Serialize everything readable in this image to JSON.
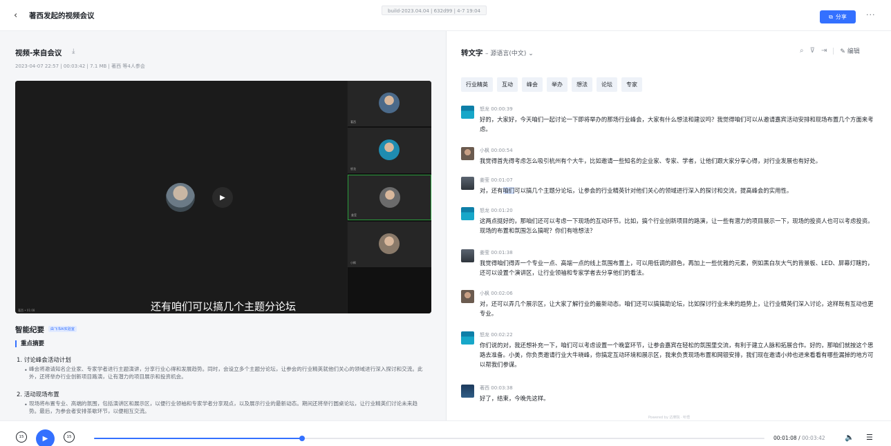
{
  "header": {
    "back_icon": "‹",
    "title": "著西发起的视频会议",
    "build": "build-2023.04.04 | 632d99 | 4-7 19:04",
    "share_label": "分享",
    "share_icon": "⧉",
    "more_icon": "···"
  },
  "left": {
    "video_title": "视频-来自会议",
    "download_icon": "⤓",
    "meta": "2023-04-07 22:57  |  00:03:42  |  7.1 MB  |  著西 等4人参会",
    "play_icon": "▶",
    "caption": "还有咱们可以搞几个主题分论坛",
    "stage_label": "著西 • 01:08",
    "tiles": [
      {
        "name": "著西",
        "color": "#4b6a8a"
      },
      {
        "name": "怒龙",
        "color": "#1f8cb0"
      },
      {
        "name": "姜莹",
        "color": "#6b6b6b"
      },
      {
        "name": "小枫",
        "color": "#8a7a6a"
      }
    ],
    "smart_title": "智能纪要",
    "smart_badge": "由飞书AI实验室",
    "key_points": "重点摘要",
    "sections": [
      {
        "heading": "1. 讨论峰会活动计划",
        "body": "峰会将邀请知名企业家、专家学者进行主题演讲，分享行业心得和发展趋势。同时，会设立多个主题分论坛，让参会的行业精英就他们关心的领域进行深入探讨和交流。此外，还将举办行业创新项目路演，让有潜力的项目展示和投资机会。"
      },
      {
        "heading": "2. 活动现场布置",
        "body": "现场将布置专业、高端的氛围，包括演讲区和展示区，以便行业领袖和专家学者分享观点，以及展示行业的最新动态。期间还将举行圆桌论坛，让行业精英们讨论未来趋势。最后，为参会者安排茶歇环节，以便相互交流。"
      }
    ]
  },
  "right": {
    "title": "转文字",
    "lang": "– 源语言(中文) ⌄",
    "tool_icons": [
      "⌕",
      "⊽",
      "⇥"
    ],
    "edit_label": "✎ 编辑",
    "keywords": [
      "行业精英",
      "互动",
      "峰会",
      "举办",
      "想法",
      "论坛",
      "专家"
    ],
    "entries": [
      {
        "speaker": "怒龙",
        "time": "00:00:39",
        "avatar": "teal",
        "text": "好的，大家好，今天咱们一起讨论一下即将举办的那场行业峰会，大家有什么想法和建议吗？我觉得咱们可以从邀请嘉宾活动安排和现场布置几个方面来考虑。"
      },
      {
        "speaker": "小枫",
        "time": "00:00:54",
        "avatar": "person",
        "text": "我觉得首先得考虑怎么吸引杭州有个大牛，比如邀请一些知名的企业家、专家、学者，让他们跟大家分享心得，对行业发展也有好处。"
      },
      {
        "speaker": "姜莹",
        "time": "00:01:07",
        "avatar": "gray",
        "pre": "对，还有",
        "hl": "咱们",
        "post": "可以搞几个主题分论坛，让参会的行业精英针对他们关心的领域进行深入的探讨和交流，提高峰会的实用性。"
      },
      {
        "speaker": "怒龙",
        "time": "00:01:20",
        "avatar": "teal",
        "text": "这两点挺好的，那咱们还可以考虑一下现场的互动环节。比如，搞个行业创新项目的路演，让一些有潜力的项目展示一下，现场的投资人也可以考虑投资。现场的布置和氛围怎么搞呢？你们有啥想法？"
      },
      {
        "speaker": "姜莹",
        "time": "00:01:38",
        "avatar": "gray",
        "text": "我觉得咱们得弄一个专业一点、高端一点的线上氛围布置上，可以用低调的颜色，再加上一些优雅的元素，例如黑白灰大气的背景板、LED、屏幕灯瞎的，还可以设置个演讲区，让行业领袖和专家学者去分享他们的看法。"
      },
      {
        "speaker": "小枫",
        "time": "00:02:06",
        "avatar": "person",
        "text": "对，还可以弄几个展示区，让大家了解行业的最新动态。咱们还可以搞搞助论坛，比如探讨行业未来的趋势上，让行业精英们深入讨论，这样既有互动也更专业。"
      },
      {
        "speaker": "怒龙",
        "time": "00:02:22",
        "avatar": "teal",
        "text": "你们说的对，我还想补充一下，咱们可以考虑设置一个晚宴环节，让参会嘉宾在轻松的氛围里交流，有利于建立人脉和拓展合作。好的，那咱们就按这个思路去准备。小美，你负责邀请行业大牛晓峰，你搞定互动环境和展示区，我来负责现场布置和网银安排，我们现在邀请小帅也进来看看有哪些漏掉的地方可以帮我们参谋。"
      },
      {
        "speaker": "著西",
        "time": "00:03:38",
        "avatar": "navy",
        "text": "好了，结束，今晚先这样。"
      }
    ],
    "powered": "Powered by 达摩院 · 听悟"
  },
  "player_bar": {
    "rewind_label": "15",
    "play_icon": "▶",
    "forward_label": "15",
    "current": "00:01:08",
    "duration": "00:03:42",
    "progress": 0.31,
    "volume_icon": "🔈",
    "settings_icon": "☰"
  }
}
